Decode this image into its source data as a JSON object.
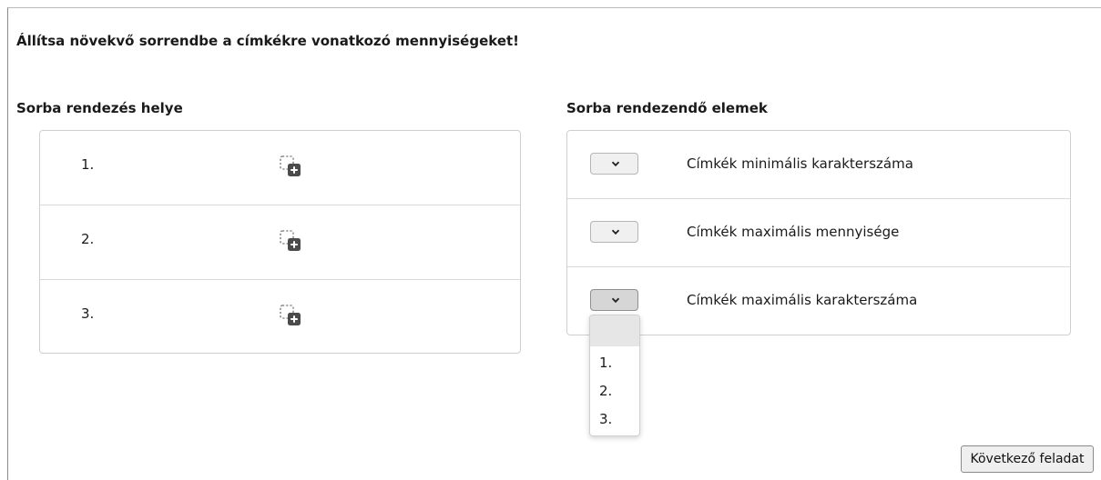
{
  "task": {
    "prompt": "Állítsa növekvő sorrendbe a címkékre vonatkozó mennyiségeket!"
  },
  "left_panel": {
    "title": "Sorba rendezés helye",
    "rows": [
      {
        "number": "1.",
        "slot_icon": "add-placeholder-icon"
      },
      {
        "number": "2.",
        "slot_icon": "add-placeholder-icon"
      },
      {
        "number": "3.",
        "slot_icon": "add-placeholder-icon"
      }
    ]
  },
  "right_panel": {
    "title": "Sorba rendezendő elemek",
    "items": [
      {
        "label": "Címkék minimális karakterszáma",
        "selected": ""
      },
      {
        "label": "Címkék maximális mennyisége",
        "selected": ""
      },
      {
        "label": "Címkék maximális karakterszáma",
        "selected": "",
        "open": true
      }
    ]
  },
  "dropdown": {
    "options": [
      "",
      "1.",
      "2.",
      "3."
    ],
    "highlighted_index": 0
  },
  "footer": {
    "next_button": "Következő feladat"
  },
  "colors": {
    "border": "#cfcfcf",
    "row_divider": "#d9d9d9",
    "select_bg": "#f0f0f0",
    "select_active_bg": "#d6d6d6",
    "option_highlight": "#e6e6e6"
  }
}
